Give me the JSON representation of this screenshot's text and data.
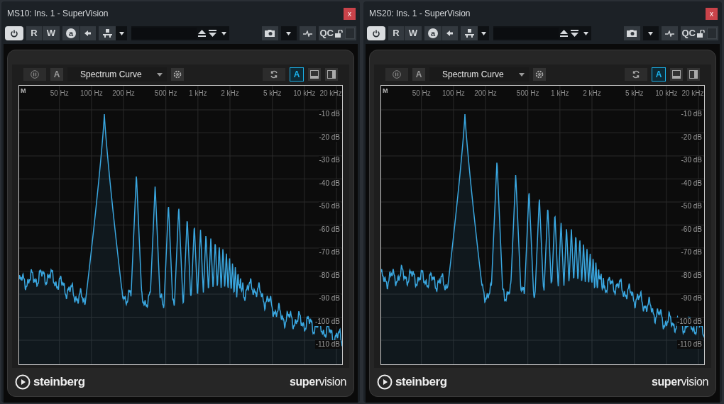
{
  "windows": [
    {
      "title": "MS10: Ins. 1 - SuperVision",
      "close_label": "x",
      "power_on": true,
      "toolbar_labels": {
        "read": "R",
        "write": "W",
        "auto": "a",
        "qc": "QC"
      },
      "module": {
        "freeze_label": "A",
        "view": "Spectrum Curve",
        "a_toggle": {
          "label": "A",
          "selected": true
        },
        "channel": "M",
        "freq_labels": [
          "50 Hz",
          "100 Hz",
          "200 Hz",
          "500 Hz",
          "1 kHz",
          "2 kHz",
          "5 kHz",
          "10 kHz",
          "20 kHz"
        ],
        "db_labels": [
          "-10 dB",
          "-20 dB",
          "-30 dB",
          "-40 dB",
          "-50 dB",
          "-60 dB",
          "-70 dB",
          "-80 dB",
          "-90 dB",
          "-100 dB",
          "-110 dB"
        ]
      },
      "logo": {
        "brand": "steinberg",
        "product": "**super**vision"
      }
    },
    {
      "title": "MS20: Ins. 1 - SuperVision",
      "close_label": "x",
      "power_on": true,
      "toolbar_labels": {
        "read": "R",
        "write": "W",
        "auto": "a",
        "qc": "QC"
      },
      "module": {
        "freeze_label": "A",
        "view": "Spectrum Curve",
        "a_toggle": {
          "label": "A",
          "selected": true
        },
        "channel": "M",
        "freq_labels": [
          "50 Hz",
          "100 Hz",
          "200 Hz",
          "500 Hz",
          "1 kHz",
          "2 kHz",
          "5 kHz",
          "10 kHz",
          "20 kHz"
        ],
        "db_labels": [
          "-10 dB",
          "-20 dB",
          "-30 dB",
          "-40 dB",
          "-50 dB",
          "-60 dB",
          "-70 dB",
          "-80 dB",
          "-90 dB",
          "-100 dB",
          "-110 dB"
        ]
      },
      "logo": {
        "brand": "steinberg",
        "product": "**super**vision"
      }
    }
  ]
}
